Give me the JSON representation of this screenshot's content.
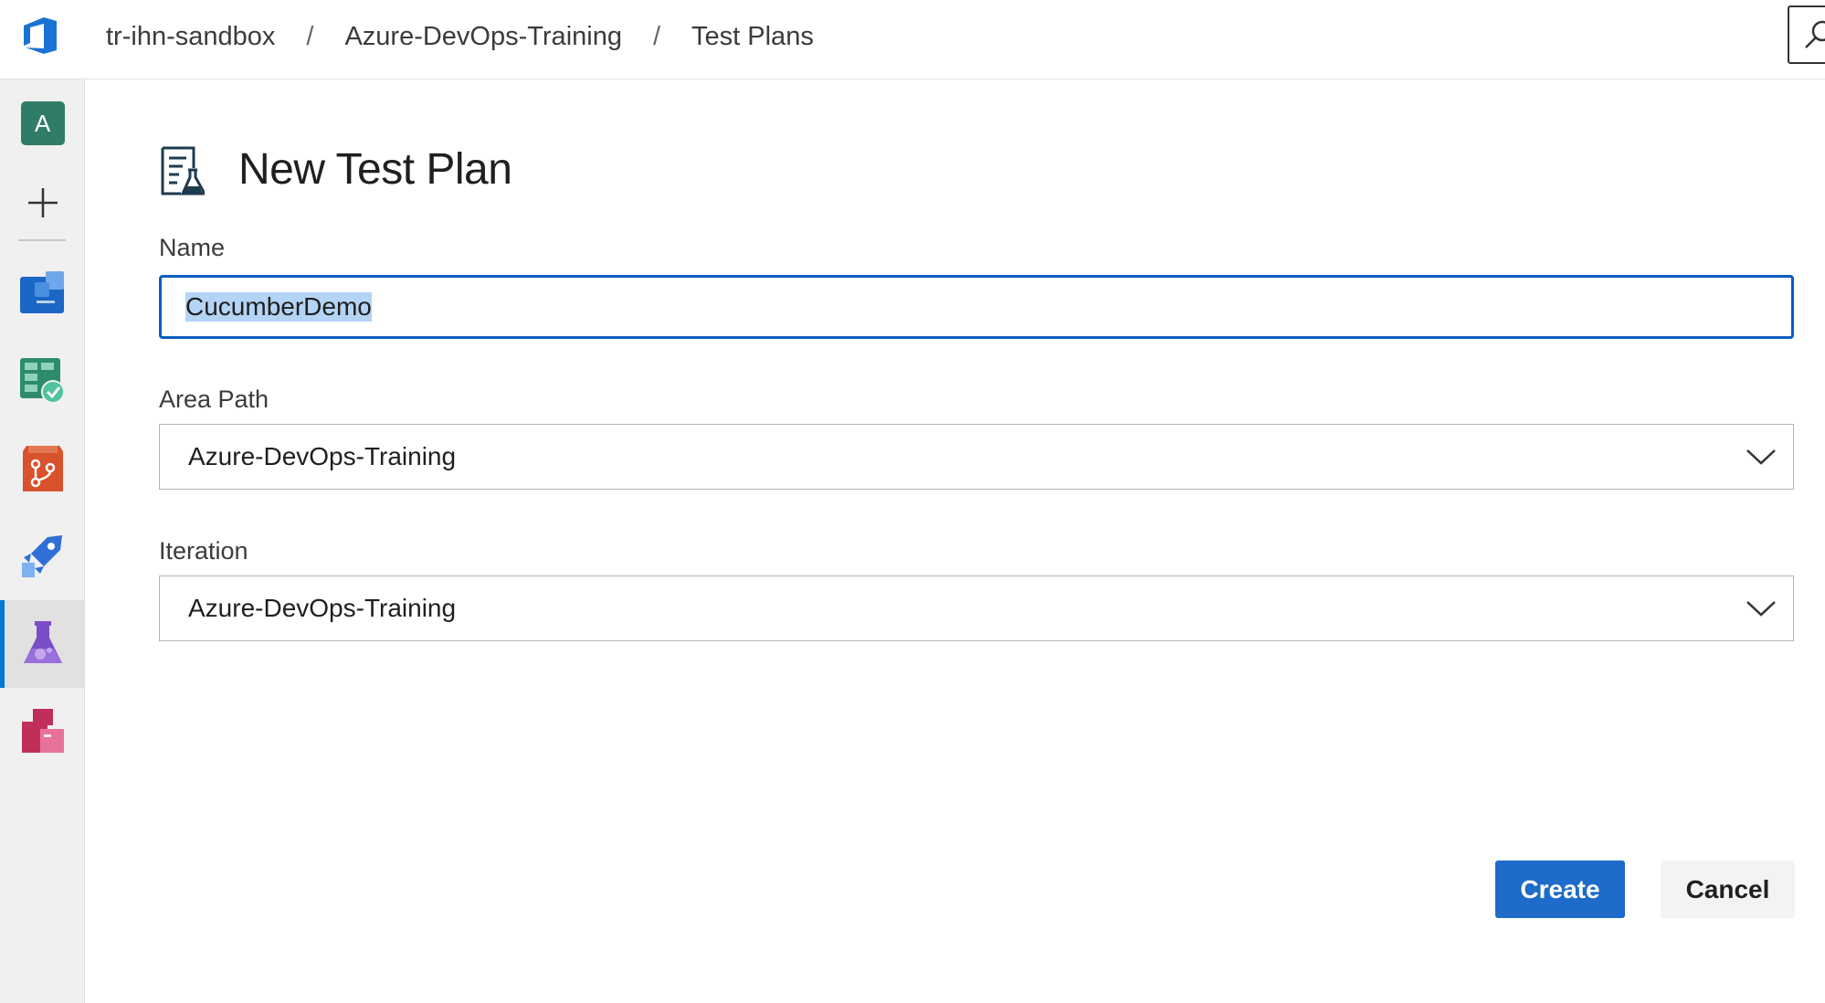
{
  "topbar": {
    "logo_icon": "azure-devops-logo-icon",
    "breadcrumbs": [
      {
        "label": "tr-ihn-sandbox"
      },
      {
        "label": "Azure-DevOps-Training"
      },
      {
        "label": "Test Plans"
      }
    ],
    "separator": "/",
    "search_icon": "search-icon"
  },
  "rail": {
    "avatar_letter": "A",
    "items": [
      {
        "name": "add-icon"
      },
      {
        "name": "overview-icon"
      },
      {
        "name": "boards-icon"
      },
      {
        "name": "repos-icon"
      },
      {
        "name": "pipelines-icon"
      },
      {
        "name": "test-plans-icon"
      },
      {
        "name": "artifacts-icon"
      }
    ]
  },
  "form": {
    "title": "New Test Plan",
    "name_label": "Name",
    "name_value": "CucumberDemo",
    "area_path_label": "Area Path",
    "area_path_value": "Azure-DevOps-Training",
    "iteration_label": "Iteration",
    "iteration_value": "Azure-DevOps-Training",
    "create_label": "Create",
    "cancel_label": "Cancel"
  },
  "colors": {
    "accent": "#1e6bc9",
    "focus_border": "#0a5dc2",
    "avatar": "#2f7d68",
    "selection": "#b3d4f5"
  }
}
